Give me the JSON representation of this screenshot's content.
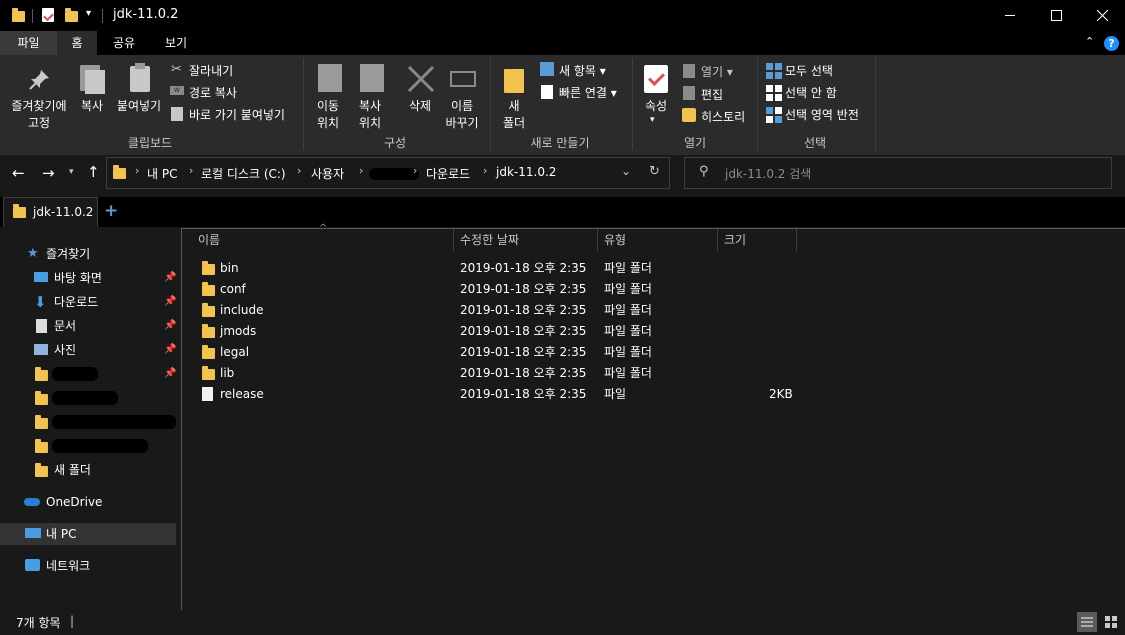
{
  "window": {
    "title": "jdk-11.0.2",
    "controls": [
      "minimize",
      "maximize",
      "close"
    ]
  },
  "menu": {
    "tabs": [
      "파일",
      "홈",
      "공유",
      "보기"
    ],
    "help": "?"
  },
  "ribbon": {
    "clipboard": {
      "pin_label_1": "즐겨찾기에",
      "pin_label_2": "고정",
      "copy": "복사",
      "paste": "붙여넣기",
      "cut": "잘라내기",
      "copy_path": "경로 복사",
      "paste_shortcut": "바로 가기 붙여넣기",
      "group": "클립보드"
    },
    "organize": {
      "move_1": "이동",
      "move_2": "위치",
      "copy_1": "복사",
      "copy_2": "위치",
      "delete": "삭제",
      "rename_1": "이름",
      "rename_2": "바꾸기",
      "group": "구성"
    },
    "new": {
      "new_folder_1": "새",
      "new_folder_2": "폴더",
      "new_item": "새 항목",
      "easy_access": "빠른 연결",
      "group": "새로 만들기"
    },
    "open": {
      "properties": "속성",
      "open": "열기",
      "edit": "편집",
      "history": "히스토리",
      "group": "열기"
    },
    "select": {
      "select_all": "모두 선택",
      "select_none": "선택 안 함",
      "invert": "선택 영역 반전",
      "group": "선택"
    }
  },
  "address": {
    "crumbs": [
      "내 PC",
      "로컬 디스크 (C:)",
      "사용자",
      "다운로드",
      "jdk-11.0.2"
    ],
    "search_placeholder": "jdk-11.0.2 검색"
  },
  "tabs": {
    "active": "jdk-11.0.2",
    "new_tab": "+"
  },
  "nav": {
    "quick_access": "즐겨찾기",
    "pinned": [
      "바탕 화면",
      "다운로드",
      "문서",
      "사진"
    ],
    "new_folder": "새 폴더",
    "onedrive": "OneDrive",
    "this_pc": "내 PC",
    "network": "네트워크"
  },
  "columns": [
    "이름",
    "수정한 날짜",
    "유형",
    "크기"
  ],
  "files": [
    {
      "name": "bin",
      "date": "2019-01-18 오후 2:35",
      "type": "파일 폴더",
      "size": "",
      "kind": "folder-icon"
    },
    {
      "name": "conf",
      "date": "2019-01-18 오후 2:35",
      "type": "파일 폴더",
      "size": "",
      "kind": "folder-icon"
    },
    {
      "name": "include",
      "date": "2019-01-18 오후 2:35",
      "type": "파일 폴더",
      "size": "",
      "kind": "folder-icon"
    },
    {
      "name": "jmods",
      "date": "2019-01-18 오후 2:35",
      "type": "파일 폴더",
      "size": "",
      "kind": "folder-icon"
    },
    {
      "name": "legal",
      "date": "2019-01-18 오후 2:35",
      "type": "파일 폴더",
      "size": "",
      "kind": "folder-icon"
    },
    {
      "name": "lib",
      "date": "2019-01-18 오후 2:35",
      "type": "파일 폴더",
      "size": "",
      "kind": "folder-icon"
    },
    {
      "name": "release",
      "date": "2019-01-18 오후 2:35",
      "type": "파일",
      "size": "2KB",
      "kind": "file-icon"
    }
  ],
  "status": {
    "count": "7개 항목",
    "sep": "|"
  },
  "colors": {
    "folder": "#f3c350",
    "accent": "#1e90ff",
    "background": "#191919"
  }
}
